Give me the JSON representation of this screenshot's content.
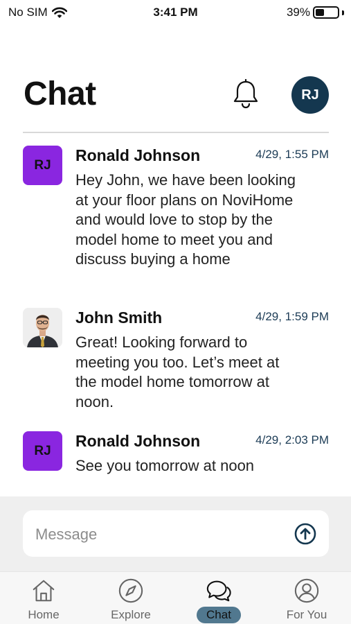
{
  "status_bar": {
    "carrier": "No SIM",
    "time": "3:41 PM",
    "battery": "39%",
    "battery_level": 0.39
  },
  "header": {
    "title": "Chat",
    "avatar_initials": "RJ",
    "avatar_color": "#14374f"
  },
  "messages": [
    {
      "sender": "Ronald Johnson",
      "initials": "RJ",
      "avatar_color": "#8a26e0",
      "time": "4/29, 1:55 PM",
      "text": "Hey John, we have been looking at your floor plans on NoviHome and would love to stop by the model home to meet you and discuss buying a home"
    },
    {
      "sender": "John Smith",
      "avatar": "profile-photo",
      "time": "4/29, 1:59 PM",
      "text": "Great!  Looking forward to meeting you too. Let’s meet at the model home tomorrow at noon."
    },
    {
      "sender": "Ronald Johnson",
      "initials": "RJ",
      "avatar_color": "#8a26e0",
      "time": "4/29, 2:03 PM",
      "text": "See you tomorrow at noon"
    }
  ],
  "composer": {
    "placeholder": "Message",
    "value": ""
  },
  "tabs": [
    {
      "label": "Home",
      "icon": "home-icon",
      "active": false
    },
    {
      "label": "Explore",
      "icon": "compass-icon",
      "active": false
    },
    {
      "label": "Chat",
      "icon": "chat-bubbles-icon",
      "active": true
    },
    {
      "label": "For You",
      "icon": "person-icon",
      "active": false
    }
  ],
  "colors": {
    "accent": "#14374f",
    "active_tab": "#51788f",
    "avatar_purple": "#8a26e0"
  }
}
